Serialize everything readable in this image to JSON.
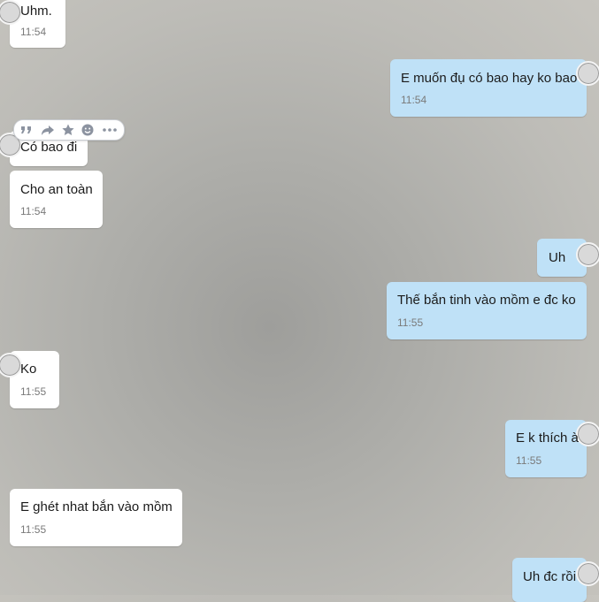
{
  "messages": [
    {
      "side": "in",
      "text": "Uhm.",
      "time": "11:54"
    },
    {
      "side": "out",
      "text": "E muốn đụ có bao hay ko bao",
      "time": "11:54"
    },
    {
      "side": "in",
      "text": "Có bao đi",
      "time": ""
    },
    {
      "side": "in",
      "text": "Cho an toàn",
      "time": "11:54"
    },
    {
      "side": "out",
      "text": "Uh",
      "time": ""
    },
    {
      "side": "out",
      "text": "Thế bắn tinh vào mồm e đc ko",
      "time": "11:55"
    },
    {
      "side": "in",
      "text": "Ko",
      "time": "11:55"
    },
    {
      "side": "out",
      "text": "E k thích à",
      "time": "11:55"
    },
    {
      "side": "in",
      "text": "E ghét nhat bắn vào mồm",
      "time": "11:55"
    },
    {
      "side": "out",
      "text": "Uh đc rồi",
      "time": ""
    }
  ],
  "toolbar": {
    "icons": [
      "quote-icon",
      "forward-icon",
      "star-icon",
      "emoji-icon",
      "more-icon"
    ]
  },
  "colors": {
    "incoming_bubble": "#ffffff",
    "outgoing_bubble": "#bfe1f7",
    "timestamp": "#7a7a7a",
    "toolbar_icon": "#8c93a0"
  }
}
